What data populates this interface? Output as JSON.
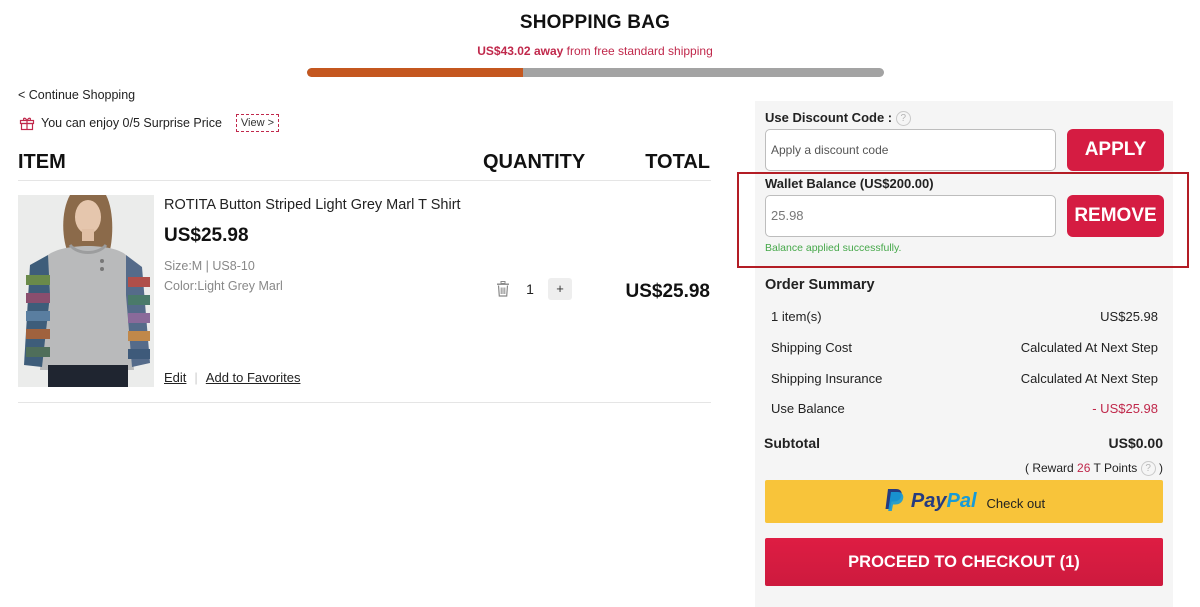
{
  "header": {
    "title": "SHOPPING BAG",
    "shipping_amount": "US$43.02",
    "shipping_away": "away",
    "shipping_rest": "from free standard shipping",
    "shipping_progress_pct": 37.5
  },
  "links": {
    "continue": "< Continue Shopping",
    "surprise_text": "You can enjoy 0/5 Surprise Price",
    "view": "View >"
  },
  "table": {
    "item_head": "ITEM",
    "quantity_head": "QUANTITY",
    "total_head": "TOTAL"
  },
  "product": {
    "name": "ROTITA Button Striped Light Grey Marl T Shirt",
    "price": "US$25.98",
    "size": "Size:M | US8-10",
    "color": "Color:Light Grey Marl",
    "quantity": "1",
    "plus": "+",
    "total": "US$25.98",
    "edit": "Edit",
    "separator": "|",
    "favorites": "Add to Favorites"
  },
  "discount": {
    "label": "Use Discount Code :",
    "help": "?",
    "placeholder": "Apply a discount code",
    "apply": "APPLY"
  },
  "wallet": {
    "label": "Wallet Balance (US$200.00)",
    "value": "25.98",
    "remove": "REMOVE",
    "success": "Balance applied successfully."
  },
  "summary": {
    "title": "Order Summary",
    "rows": [
      {
        "label": "1 item(s)",
        "value": "US$25.98"
      },
      {
        "label": "Shipping Cost",
        "value": "Calculated At Next Step"
      },
      {
        "label": "Shipping Insurance",
        "value": "Calculated At Next Step"
      },
      {
        "label": "Use Balance",
        "value": "- US$25.98"
      }
    ],
    "subtotal_label": "Subtotal",
    "subtotal_value": "US$0.00",
    "reward_open": "( Reward",
    "reward_points": "26",
    "reward_unit": "T Points",
    "reward_close": ")"
  },
  "paypal": {
    "word_a": "Pay",
    "word_b": "Pal",
    "checkout": "Check out"
  },
  "checkout": {
    "label": "PROCEED TO CHECKOUT (1)"
  },
  "colors": {
    "accent_red": "#d51c42",
    "progress_fill": "#c4571f",
    "paypal_yellow": "#f8c43a",
    "highlight_border": "#b31d25"
  }
}
